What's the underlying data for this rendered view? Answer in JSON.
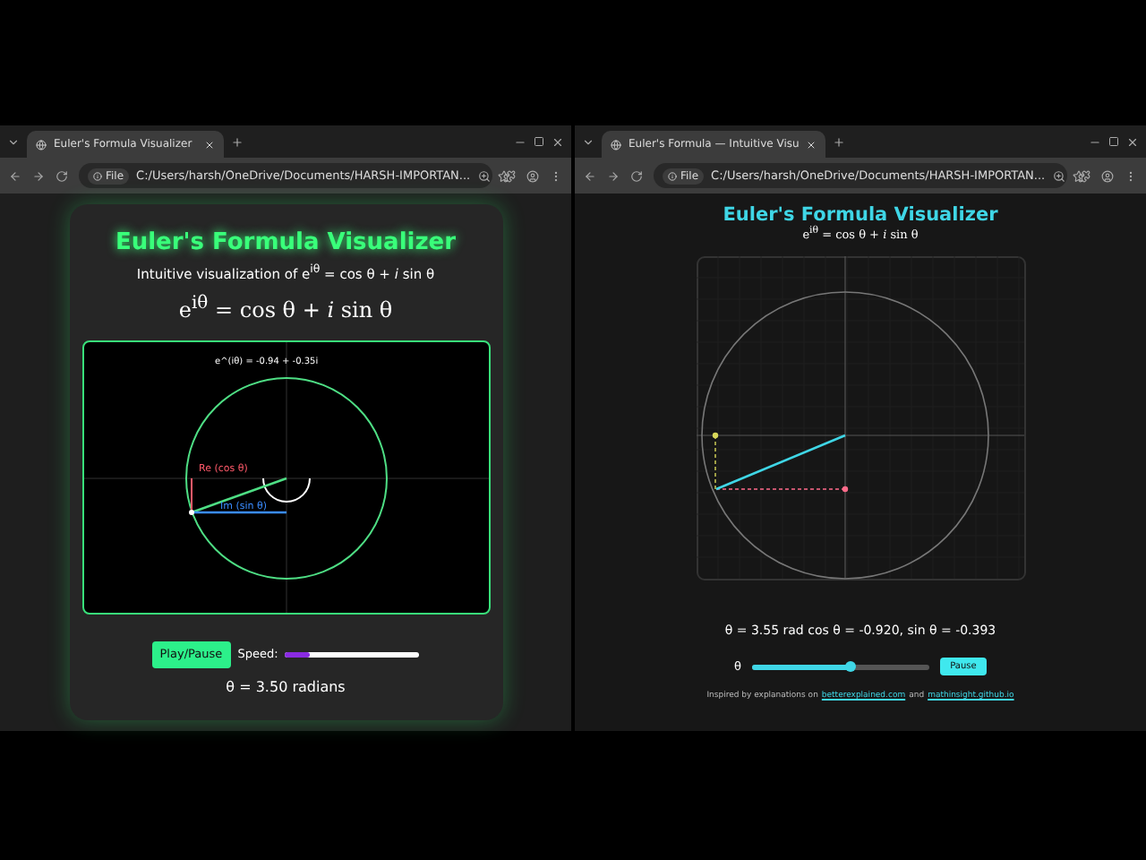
{
  "windows": [
    {
      "tab": {
        "title": "Euler's Formula Visualizer",
        "selected": true
      },
      "address": {
        "chip": "File",
        "url": "C:/Users/harsh/OneDrive/Documents/HARSH-IMPORTAN..."
      },
      "page": {
        "kind": "card",
        "title": "Euler's Formula Visualizer",
        "subtitle": "Intuitive visualization of e$^{iθ}$ = cos θ + *i* sin θ",
        "formula": "e$^{iθ}$ = cos θ + *i* sin θ",
        "canvas": {
          "value_label": "e^(iθ) = -0.94 + -0.35i",
          "re_label": "Re (cos θ)",
          "im_label": "Im (sin θ)"
        },
        "button": "Play/Pause",
        "slider": {
          "label": "Speed:",
          "level": 0.18
        },
        "reading": "θ = 3.50 radians"
      }
    },
    {
      "tab": {
        "title": "Euler's Formula — Intuitive Visu",
        "selected": true
      },
      "address": {
        "chip": "File",
        "url": "C:/Users/harsh/OneDrive/Documents/HARSH-IMPORTAN..."
      },
      "page": {
        "kind": "plot",
        "title": "Euler's Formula Visualizer",
        "formula": "e$^{iθ}$ = cos θ + *i* sin θ",
        "reading": "θ = 3.55 rad  cos θ = -0.920, sin θ = -0.393",
        "slider": {
          "label": "θ",
          "level": 0.56
        },
        "button": "Pause",
        "footer": {
          "text": "Inspired by explanations on",
          "link_1": "betterexplained.com",
          "joiner": "and",
          "link_2": "mathinsight.github.io"
        }
      }
    }
  ]
}
